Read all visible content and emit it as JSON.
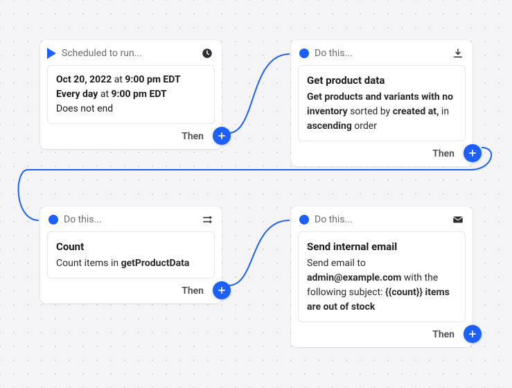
{
  "nodes": {
    "trigger": {
      "header": "Scheduled to run...",
      "body_parts": {
        "date": "Oct 20, 2022",
        "at1": " at ",
        "time1": "9:00 pm EDT",
        "line2_a": "Every day",
        "line2_b": " at ",
        "line2_c": "9:00 pm EDT",
        "line3": "Does not end"
      },
      "footer": "Then"
    },
    "getdata": {
      "header": "Do this...",
      "title": "Get product data",
      "desc_parts": {
        "a": "Get products and variants with no inventory",
        "b": " sorted by ",
        "c": "created at,",
        "d": " in ",
        "e": "ascending",
        "f": " order"
      },
      "footer": "Then"
    },
    "count": {
      "header": "Do this...",
      "title": "Count",
      "desc_a": "Count items in ",
      "desc_b": "getProductData",
      "footer": "Then"
    },
    "email": {
      "header": "Do this...",
      "title": "Send internal email",
      "desc_a": "Send email to ",
      "desc_b": "admin@example.com",
      "desc_c": " with the following subject: ",
      "desc_d": "{{count}} items are out of stock",
      "footer": "Then"
    }
  }
}
